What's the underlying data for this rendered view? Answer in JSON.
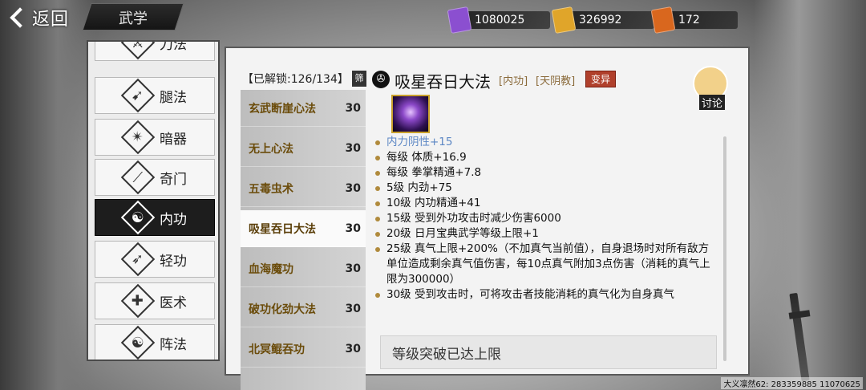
{
  "header": {
    "back_label": "返回",
    "title": "武学",
    "currencies": [
      {
        "icon": "purple-token-icon",
        "color": "#8b4fd0",
        "value": "1080025"
      },
      {
        "icon": "gold-token-icon",
        "color": "#e0a52a",
        "value": "326992"
      },
      {
        "icon": "flame-token-icon",
        "color": "#d9671e",
        "value": "172"
      }
    ]
  },
  "categories": [
    {
      "label": "刀法"
    },
    {
      "label": "腿法"
    },
    {
      "label": "暗器"
    },
    {
      "label": "奇门"
    },
    {
      "label": "内功",
      "active": true
    },
    {
      "label": "轻功"
    },
    {
      "label": "医术"
    },
    {
      "label": "阵法"
    }
  ],
  "skill_list": {
    "unlock_label": "【已解锁:126/134】",
    "filter_label": "筛",
    "items": [
      {
        "name": "玄武断崖心法",
        "level": "30"
      },
      {
        "name": "无上心法",
        "level": "30"
      },
      {
        "name": "五毒虫术",
        "level": "30"
      },
      {
        "name": "吸星吞日大法",
        "level": "30",
        "active": true
      },
      {
        "name": "血海魔功",
        "level": "30"
      },
      {
        "name": "破功化劲大法",
        "level": "30"
      },
      {
        "name": "北冥鲲吞功",
        "level": "30"
      }
    ]
  },
  "detail": {
    "title": "吸星吞日大法",
    "tag_type": "[内功]",
    "tag_sect": "[天阴教]",
    "badge": "变异",
    "discuss_label": "讨论",
    "attributes": [
      {
        "text": "内力阴性+15",
        "highlight": true
      },
      {
        "text": "每级  体质+16.9"
      },
      {
        "text": "每级  拳掌精通+7.8"
      },
      {
        "text": "5级   内劲+75"
      },
      {
        "text": "10级  内功精通+41"
      },
      {
        "text": "15级  受到外功攻击时减少伤害6000"
      },
      {
        "text": "20级  日月宝典武学等级上限+1"
      },
      {
        "text": "25级  真气上限+200%（不加真气当前值），自身退场时对所有敌方单位造成剩余真气值伤害，每10点真气附加3点伤害（消耗的真气上限为300000）"
      },
      {
        "text": "30级  受到攻击时，可将攻击者技能消耗的真气化为自身真气"
      }
    ],
    "limit_text": "等级突破已达上限"
  },
  "footer": "大义凛然62: 283359885  11070625"
}
